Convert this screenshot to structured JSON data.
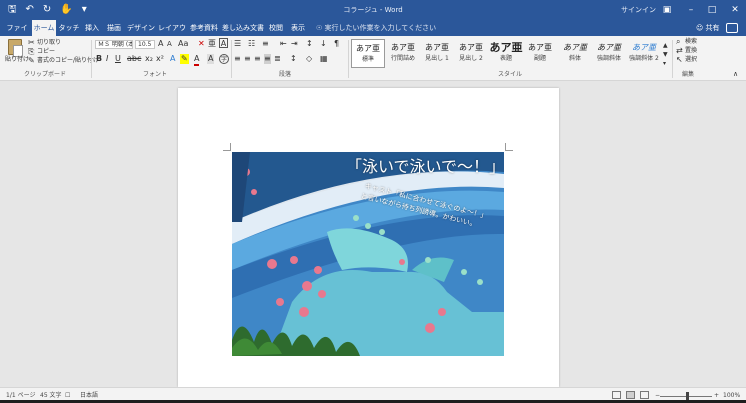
{
  "window": {
    "title": "コラージュ - Word",
    "sign_in": "サインイン",
    "qat_icons": [
      "save-icon",
      "undo-icon",
      "redo-icon",
      "touch-mode-icon",
      "customize-icon"
    ],
    "controls": [
      "ribbon-display-icon",
      "minimize-icon",
      "maximize-icon",
      "close-icon"
    ]
  },
  "ribbon_tabs": [
    {
      "label": "ファイル",
      "active": false
    },
    {
      "label": "ホーム",
      "active": true
    },
    {
      "label": "タッチ",
      "active": false
    },
    {
      "label": "挿入",
      "active": false
    },
    {
      "label": "描画",
      "active": false
    },
    {
      "label": "デザイン",
      "active": false
    },
    {
      "label": "レイアウト",
      "active": false
    },
    {
      "label": "参考資料",
      "active": false
    },
    {
      "label": "差し込み文書",
      "active": false
    },
    {
      "label": "校閲",
      "active": false
    },
    {
      "label": "表示",
      "active": false
    }
  ],
  "tell_me": "実行したい作業を入力してください",
  "share": "共有",
  "clipboard": {
    "paste": "貼り付け",
    "cut": "切り取り",
    "copy": "コピー",
    "format_painter": "書式のコピー/貼り付け",
    "group": "クリップボード"
  },
  "font": {
    "name": "ＭＳ 明朝 (本",
    "size": "10.5",
    "group": "フォント"
  },
  "paragraph": {
    "group": "段落"
  },
  "styles": {
    "items": [
      {
        "sample": "あア亜",
        "name": "標準",
        "selected": true
      },
      {
        "sample": "あア亜",
        "name": "行間詰め",
        "selected": false
      },
      {
        "sample": "あア亜",
        "name": "見出し 1",
        "selected": false
      },
      {
        "sample": "あア亜",
        "name": "見出し 2",
        "selected": false
      },
      {
        "sample": "あア亜",
        "name": "表題",
        "selected": false
      },
      {
        "sample": "あア亜",
        "name": "副題",
        "selected": false
      },
      {
        "sample": "あア亜",
        "name": "斜体",
        "selected": false
      },
      {
        "sample": "あア亜",
        "name": "強調斜体",
        "selected": false
      },
      {
        "sample": "あア亜",
        "name": "強調斜体 2",
        "selected": false
      }
    ],
    "group": "スタイル"
  },
  "editing": {
    "find": "検索",
    "replace": "置換",
    "select": "選択",
    "group": "編集"
  },
  "document": {
    "headline": "「泳いで泳いで〜！」",
    "caption_line1": "キャスト「私に合わせて泳ぐのよ〜！」",
    "caption_line2": "と言いながら待ち列誘導。かわいい。"
  },
  "status": {
    "page": "1/1 ページ",
    "words": "45 文字",
    "language": "日本語",
    "zoom": "100%"
  },
  "colors": {
    "accent": "#2b579a",
    "ribbon_bg": "#f3f3f3",
    "canvas_bg": "#e6e6e6"
  }
}
